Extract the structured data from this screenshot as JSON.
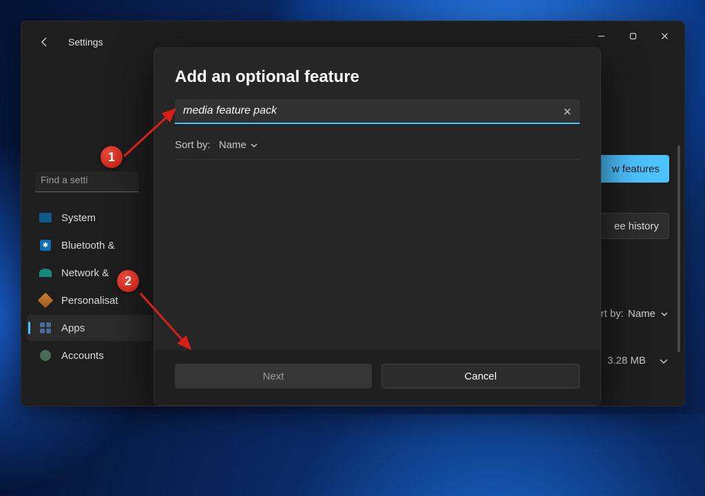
{
  "app_title": "Settings",
  "sidebar_search_placeholder": "Find a setti",
  "nav": {
    "system": "System",
    "bluetooth": "Bluetooth &",
    "network": "Network &",
    "personalisation": "Personalisat",
    "apps": "Apps",
    "accounts": "Accounts"
  },
  "right": {
    "view_features": "w features",
    "history": "ee history",
    "sort_label": "ort by:",
    "sort_value": "Name",
    "size": "3.28 MB"
  },
  "modal": {
    "title": "Add an optional feature",
    "search_value": "media feature pack",
    "sort_label": "Sort by:",
    "sort_value": "Name",
    "next": "Next",
    "cancel": "Cancel"
  },
  "annotations": {
    "one": "1",
    "two": "2"
  }
}
